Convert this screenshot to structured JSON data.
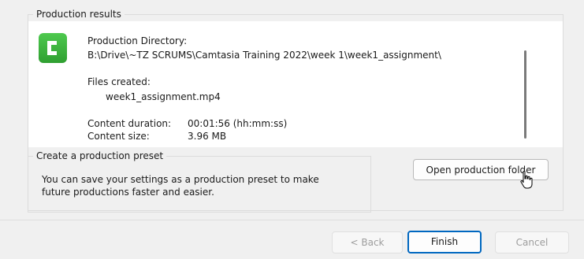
{
  "results": {
    "group_title": "Production results",
    "directory_label": "Production Directory:",
    "directory_path": "B:\\Drive\\~TZ SCRUMS\\Camtasia Training 2022\\week 1\\week1_assignment\\",
    "files_label": "Files created:",
    "file_name": "week1_assignment.mp4",
    "duration_label": "Content duration:",
    "duration_value": "00:01:56 (hh:mm:ss)",
    "size_label": "Content size:",
    "size_value": "3.96 MB",
    "logo_icon": "camtasia-logo-icon"
  },
  "preset": {
    "group_title": "Create a production preset",
    "description_line1": "You can save your settings as a production preset to make",
    "description_line2": "future productions faster and easier."
  },
  "buttons": {
    "open_folder": "Open production folder",
    "back": "< Back",
    "finish": "Finish",
    "cancel": "Cancel"
  },
  "colors": {
    "logo_green": "#3bb33d",
    "focus_blue": "#0067c0"
  }
}
